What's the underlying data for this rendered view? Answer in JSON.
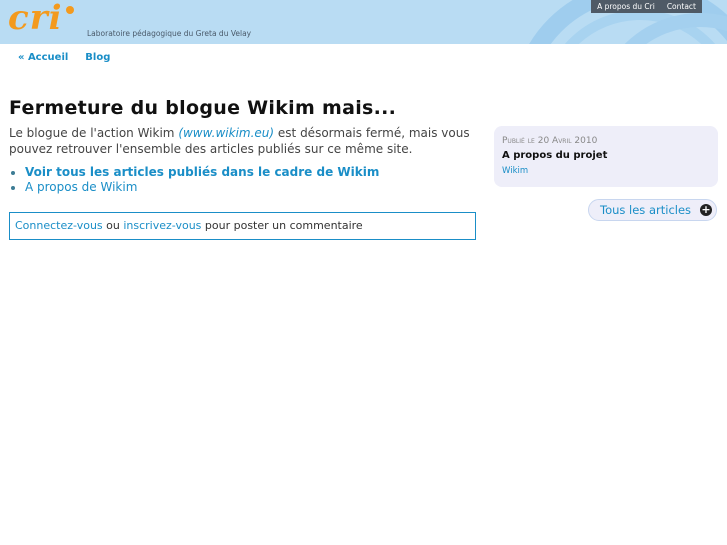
{
  "header": {
    "logo_text": "cri",
    "tagline": "Laboratoire pédagogique du Greta du Velay",
    "top_links": [
      "A propos du Cri",
      "Contact"
    ]
  },
  "subnav": {
    "home": "« Accueil",
    "blog": "Blog"
  },
  "article": {
    "title": "Fermeture du blogue Wikim mais...",
    "intro_before": "Le blogue de l'action Wikim ",
    "intro_link": "(www.wikim.eu)",
    "intro_after": " est désormais fermé, mais vous pouvez retrouver l'ensemble des articles publiés sur ce même site.",
    "links": [
      "Voir tous les articles publiés dans le cadre de Wikim",
      "A propos de Wikim"
    ]
  },
  "comment": {
    "login": "Connectez-vous",
    "or": " ou ",
    "register": "inscrivez-vous",
    "suffix": " pour poster un commentaire"
  },
  "sidebar": {
    "date_label": "Publié le",
    "date_value": "20 Avril 2010",
    "title": "A propos du projet",
    "tag": "Wikim",
    "all_articles": "Tous les articles"
  },
  "colors": {
    "header_bg": "#b9dcf3",
    "link": "#1a8ec7",
    "logo": "#f39a1e"
  }
}
